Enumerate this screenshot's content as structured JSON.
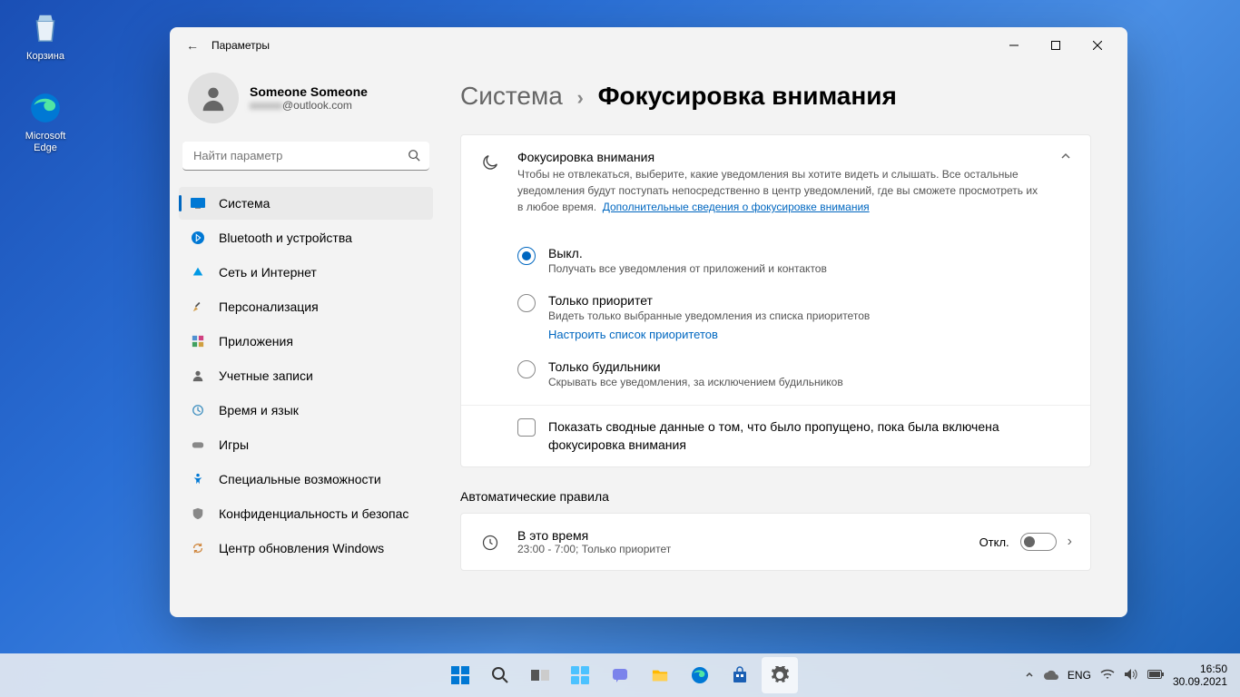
{
  "desktop": {
    "recycle": "Корзина",
    "edge": "Microsoft Edge"
  },
  "window": {
    "title": "Параметры",
    "account": {
      "name": "Someone Someone",
      "email": "@outlook.com"
    },
    "search_placeholder": "Найти параметр",
    "nav": [
      "Система",
      "Bluetooth и устройства",
      "Сеть и Интернет",
      "Персонализация",
      "Приложения",
      "Учетные записи",
      "Время и язык",
      "Игры",
      "Специальные возможности",
      "Конфиденциальность и безопасность",
      "Центр обновления Windows"
    ],
    "breadcrumb": {
      "parent": "Система",
      "current": "Фокусировка внимания"
    },
    "focus": {
      "title": "Фокусировка внимания",
      "desc": "Чтобы не отвлекаться, выберите, какие уведомления вы хотите видеть и слышать. Все остальные уведомления будут поступать непосредственно в центр уведомлений, где вы сможете просмотреть их в любое время.",
      "link": "Дополнительные сведения о фокусировке внимания",
      "options": [
        {
          "label": "Выкл.",
          "sub": "Получать все уведомления от приложений и контактов"
        },
        {
          "label": "Только приоритет",
          "sub": "Видеть только выбранные уведомления из списка приоритетов",
          "link": "Настроить список приоритетов"
        },
        {
          "label": "Только будильники",
          "sub": "Скрывать все уведомления, за исключением будильников"
        }
      ],
      "summary_checkbox": "Показать сводные данные о том, что было пропущено, пока была включена фокусировка внимания"
    },
    "auto_rules": {
      "title": "Автоматические правила",
      "time_rule": {
        "label": "В это время",
        "sub": "23:00 - 7:00; Только приоритет",
        "state": "Откл."
      }
    }
  },
  "taskbar": {
    "lang": "ENG",
    "time": "16:50",
    "date": "30.09.2021"
  }
}
